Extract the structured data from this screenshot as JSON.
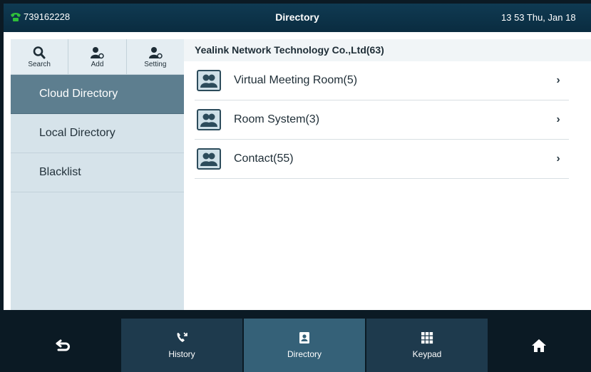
{
  "status_bar": {
    "phone_number": "739162228",
    "title": "Directory",
    "datetime": "13 53 Thu, Jan 18"
  },
  "toolbar": [
    {
      "label": "Search",
      "icon": "search-icon"
    },
    {
      "label": "Add",
      "icon": "add-contact-icon"
    },
    {
      "label": "Setting",
      "icon": "contact-setting-icon"
    }
  ],
  "nav": [
    {
      "label": "Cloud Directory",
      "active": true
    },
    {
      "label": "Local Directory",
      "active": false
    },
    {
      "label": "Blacklist",
      "active": false
    }
  ],
  "content": {
    "company": "Yealink Network Technology Co.,Ltd(63)",
    "groups": [
      {
        "label": "Virtual Meeting Room(5)"
      },
      {
        "label": "Room System(3)"
      },
      {
        "label": "Contact(55)"
      }
    ]
  },
  "bottom_nav": {
    "tabs": [
      {
        "label": "History",
        "icon": "history-icon"
      },
      {
        "label": "Directory",
        "icon": "directory-icon",
        "active": true
      },
      {
        "label": "Keypad",
        "icon": "keypad-icon"
      }
    ]
  },
  "colors": {
    "status_bar": "#0f3a52",
    "phone_icon": "#2fbf3a",
    "active_nav": "#5d7e8f",
    "active_tab": "#356178"
  }
}
